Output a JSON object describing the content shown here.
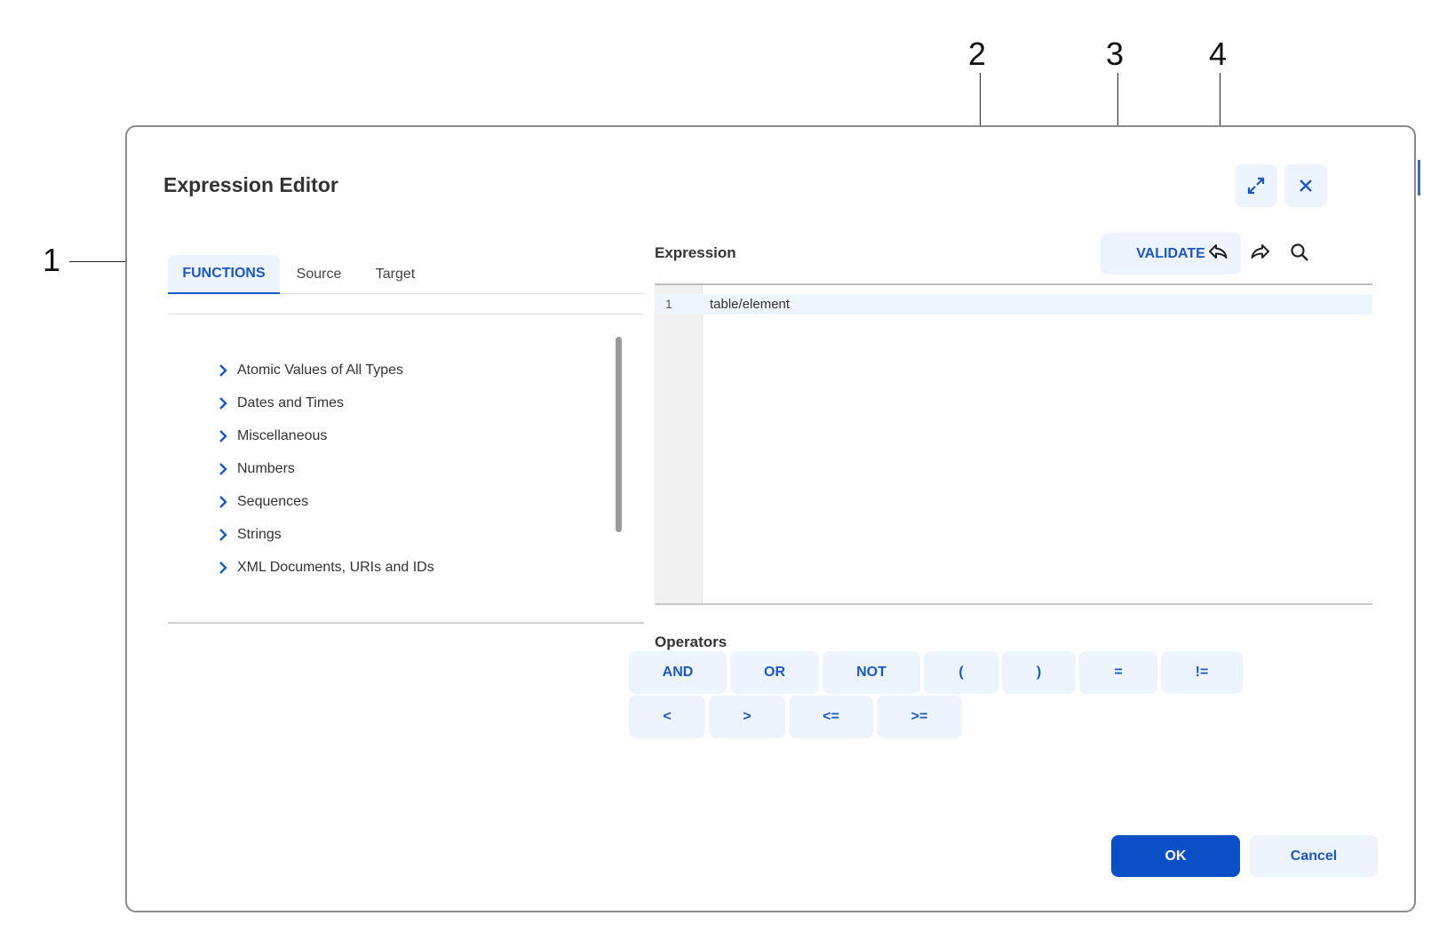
{
  "callouts": [
    "1",
    "2",
    "3",
    "4"
  ],
  "dialog": {
    "title": "Expression Editor",
    "maximize_icon": "expand-icon",
    "close_icon": "close-icon"
  },
  "left_panel": {
    "tabs": [
      {
        "label": "FUNCTIONS",
        "active": true
      },
      {
        "label": "Source",
        "active": false
      },
      {
        "label": "Target",
        "active": false
      }
    ],
    "functions": [
      "Atomic Values of All Types",
      "Dates and Times",
      "Miscellaneous",
      "Numbers",
      "Sequences",
      "Strings",
      "XML Documents, URIs and IDs"
    ]
  },
  "expression": {
    "label": "Expression",
    "validate_label": "VALIDATE",
    "undo_icon": "undo-icon",
    "redo_icon": "redo-icon",
    "search_icon": "search-icon",
    "lines": [
      {
        "number": "1",
        "text": "table/element"
      }
    ]
  },
  "operators": {
    "label": "Operators",
    "row1": [
      "AND",
      "OR",
      "NOT",
      "(",
      ")",
      "=",
      "!="
    ],
    "row2": [
      "<",
      ">",
      "<=",
      ">="
    ]
  },
  "footer": {
    "ok_label": "OK",
    "cancel_label": "Cancel"
  },
  "colors": {
    "accent": "#1b58c4",
    "primary_button": "#0b4fc7",
    "button_bg": "#eef4fd"
  }
}
